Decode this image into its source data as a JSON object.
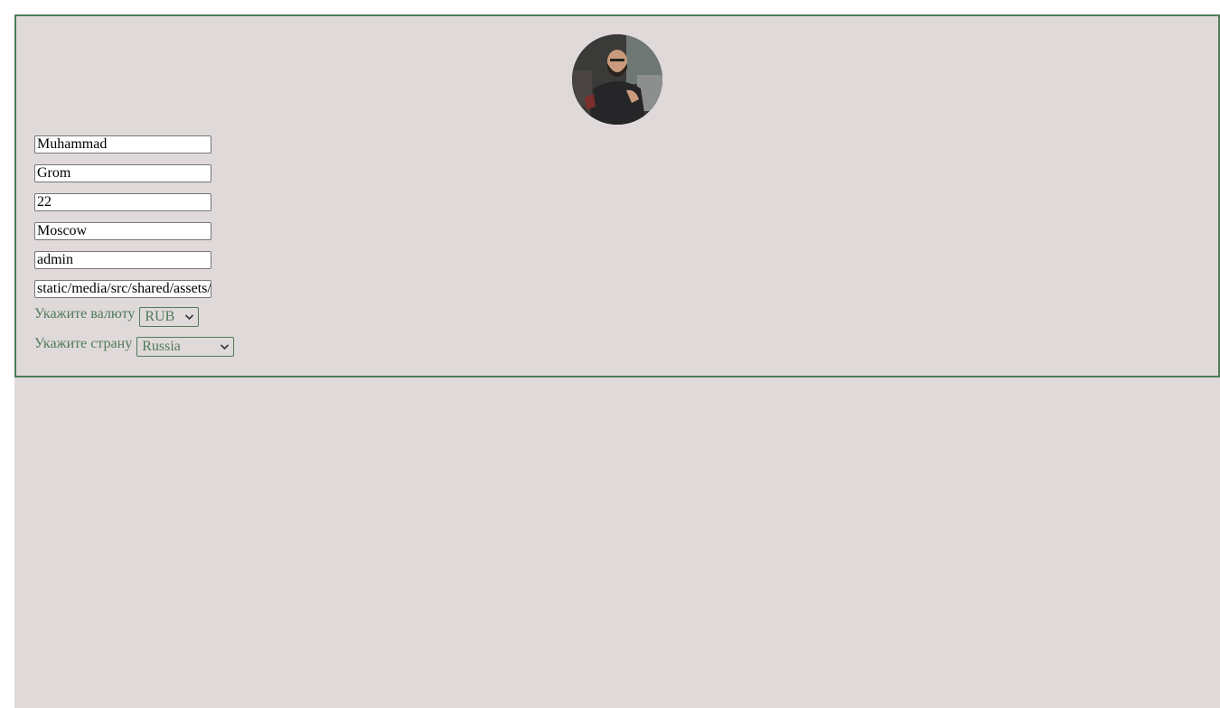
{
  "profile": {
    "avatar_icon": "user-photo",
    "fields": {
      "first_name": "Muhammad",
      "last_name": "Grom",
      "age": "22",
      "city": "Moscow",
      "username": "admin",
      "avatar_path": "static/media/src/shared/assets/"
    },
    "currency": {
      "label": "Укажите валюту",
      "selected": "RUB"
    },
    "country": {
      "label": "Укажите страну",
      "selected": "Russia"
    }
  },
  "colors": {
    "background": "#e0d9da",
    "accent": "#4e7b58"
  }
}
